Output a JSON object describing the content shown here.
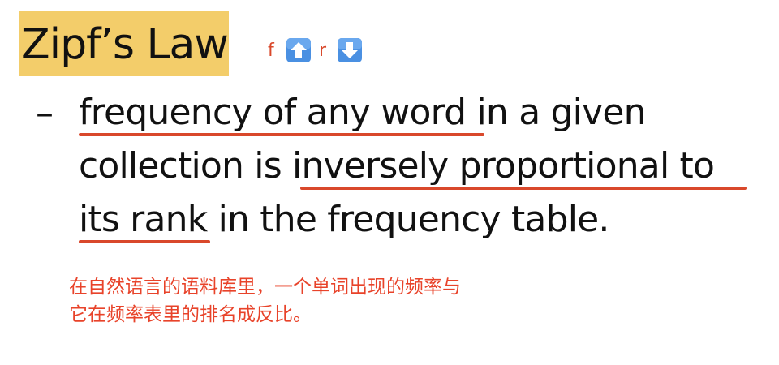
{
  "title": "Zipf’s Law",
  "annotation": {
    "letter_f": "f",
    "icon_up": "up-arrow-icon",
    "letter_r": "r",
    "icon_down": "down-arrow-icon",
    "arrow_color": "#4a90e2"
  },
  "bullet": {
    "dash": "–",
    "line1": {
      "underlined": "frequency of any word",
      "rest": " in a given"
    },
    "line2": {
      "plain": "collection is ",
      "underlined": "inversely proportional to"
    },
    "line3": {
      "underlined": "its rank",
      "rest": " in the frequency table."
    }
  },
  "chinese_note": {
    "line1": "在自然语言的语料库里，一个单词出现的频率与",
    "line2": "它在频率表里的排名成反比。"
  },
  "colors": {
    "title_highlight": "#f3cd6a",
    "underline": "#d9482b",
    "note_text": "#e8432a"
  }
}
